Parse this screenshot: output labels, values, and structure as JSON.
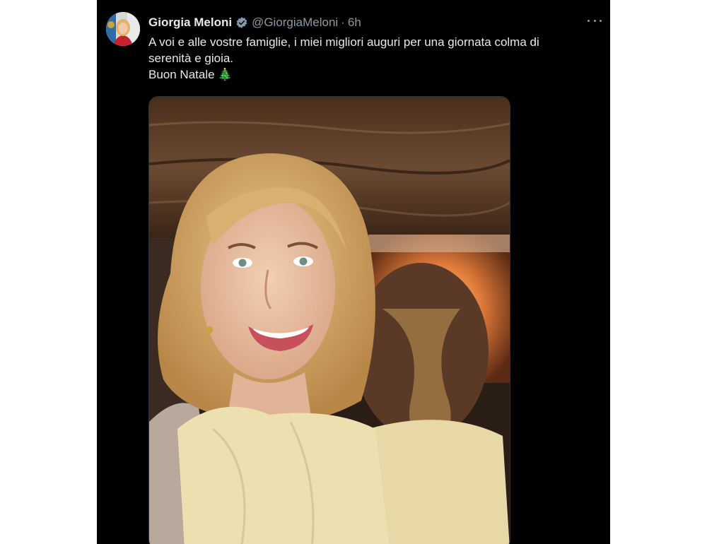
{
  "tweet": {
    "author": {
      "display_name": "Giorgia Meloni",
      "handle": "@GiorgiaMeloni",
      "verified_icon": "verified-badge-icon"
    },
    "separator": "·",
    "time": "6h",
    "more_icon": "more-options-icon",
    "text_lines": [
      "A voi e alle vostre famiglie, i miei migliori auguri per una giornata colma di",
      "serenità e gioia.",
      "Buon Natale"
    ],
    "emoji": "🎄"
  },
  "colors": {
    "background": "#000000",
    "text": "#e7e9ea",
    "secondary": "#8b98a5",
    "verified": "#829aab"
  }
}
